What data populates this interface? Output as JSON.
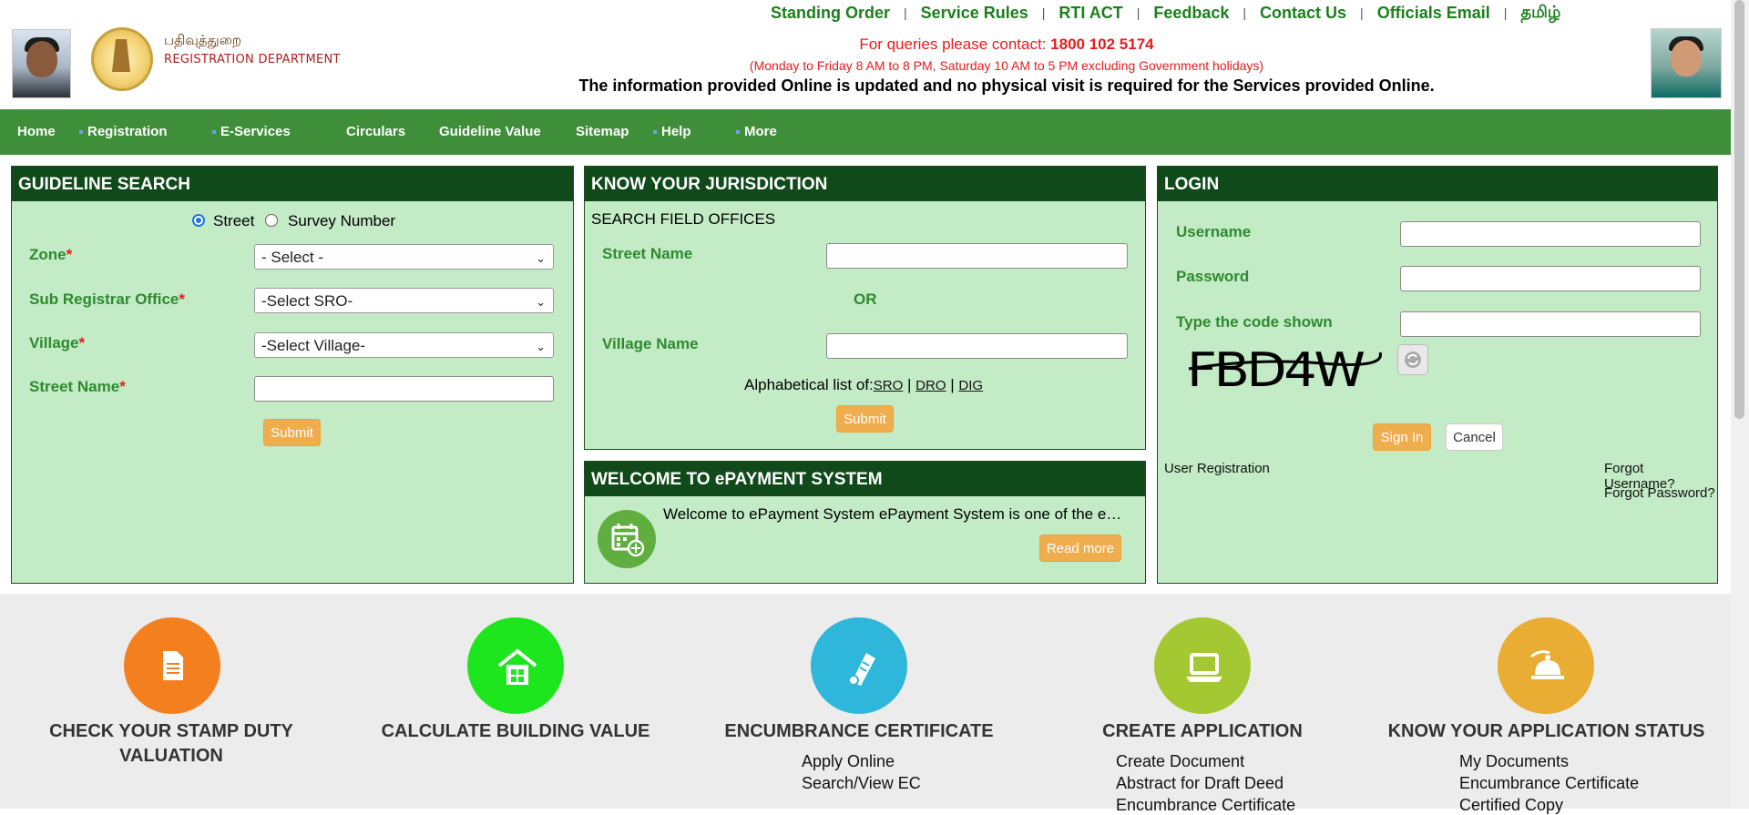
{
  "header": {
    "dept_tamil": "பதிவுத்துறை",
    "dept_english": "REGISTRATION DEPARTMENT",
    "top_links": [
      "Standing Order",
      "Service Rules",
      "RTI ACT",
      "Feedback",
      "Contact Us",
      "Officials Email",
      "தமிழ்"
    ],
    "contact_prefix": "For queries please contact: ",
    "contact_number": "1800 102 5174",
    "hours": "(Monday to Friday 8 AM to 8 PM, Saturday 10 AM to 5 PM excluding Government holidays)",
    "notice": "The information provided Online is updated and no physical visit is required for the Services provided Online."
  },
  "nav": {
    "items": [
      "Home",
      "Registration",
      "E-Services",
      "Circulars",
      "Guideline Value",
      "Sitemap",
      "Help",
      "More"
    ]
  },
  "guideline": {
    "title": "GUIDELINE SEARCH",
    "radio_street": "Street",
    "radio_survey": "Survey Number",
    "zone_label": "Zone",
    "zone_value": "- Select -",
    "sro_label": "Sub Registrar Office",
    "sro_value": "-Select SRO-",
    "village_label": "Village",
    "village_value": "-Select Village-",
    "street_label": "Street Name",
    "required": "*",
    "submit": "Submit"
  },
  "jurisdiction": {
    "title": "KNOW YOUR JURISDICTION",
    "subtitle": "SEARCH FIELD OFFICES",
    "street_label": "Street Name",
    "or": "OR",
    "village_label": "Village Name",
    "alpha_prefix": "Alphabetical list of:",
    "links": [
      "SRO",
      "DRO",
      "DIG"
    ],
    "sep": "|",
    "submit": "Submit"
  },
  "epayment": {
    "title": "WELCOME TO ePAYMENT SYSTEM",
    "text": "Welcome to ePayment System ePayment System is one of the e…",
    "read_more": "Read more"
  },
  "login": {
    "title": "LOGIN",
    "username_label": "Username",
    "password_label": "Password",
    "code_label": "Type the code shown",
    "captcha": "FBD4W",
    "sign_in": "Sign In",
    "cancel": "Cancel",
    "user_registration": "User Registration",
    "forgot_username": "Forgot Username?",
    "forgot_password": "Forgot Password?"
  },
  "services": [
    {
      "title_line1": "CHECK YOUR STAMP DUTY",
      "title_line2": "VALUATION",
      "color": "#f47f1f",
      "icon": "document-icon",
      "links": []
    },
    {
      "title_line1": "CALCULATE BUILDING VALUE",
      "title_line2": "",
      "color": "#1ee61e",
      "icon": "house-icon",
      "links": []
    },
    {
      "title_line1": "ENCUMBRANCE CERTIFICATE",
      "title_line2": "",
      "color": "#2eb7da",
      "icon": "scroll-icon",
      "links": [
        "Apply Online",
        "Search/View EC"
      ]
    },
    {
      "title_line1": "CREATE APPLICATION",
      "title_line2": "",
      "color": "#a4c832",
      "icon": "laptop-icon",
      "links": [
        "Create Document",
        "Abstract for Draft Deed",
        "Encumbrance Certificate"
      ]
    },
    {
      "title_line1": "KNOW YOUR APPLICATION STATUS",
      "title_line2": "",
      "color": "#e8ad32",
      "icon": "service-bell-icon",
      "links": [
        "My Documents",
        "Encumbrance Certificate",
        "Certified Copy"
      ]
    }
  ]
}
